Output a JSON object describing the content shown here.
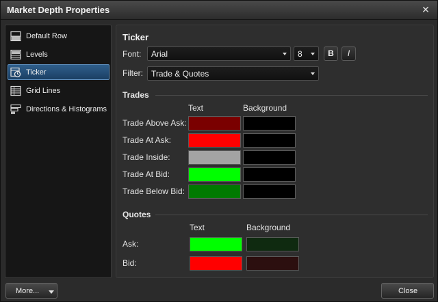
{
  "window": {
    "title": "Market Depth Properties"
  },
  "sidebar": {
    "items": [
      {
        "label": "Default Row",
        "icon": "default-row-icon"
      },
      {
        "label": "Levels",
        "icon": "levels-icon"
      },
      {
        "label": "Ticker",
        "icon": "ticker-icon",
        "active": true
      },
      {
        "label": "Grid Lines",
        "icon": "grid-lines-icon"
      },
      {
        "label": "Directions & Histograms",
        "icon": "directions-histograms-icon"
      }
    ]
  },
  "ticker": {
    "heading": "Ticker",
    "font_label": "Font:",
    "font_value": "Arial",
    "size_value": "8",
    "bold_label": "B",
    "italic_label": "I",
    "filter_label": "Filter:",
    "filter_value": "Trade & Quotes"
  },
  "trades": {
    "heading": "Trades",
    "col_text": "Text",
    "col_background": "Background",
    "rows": [
      {
        "label": "Trade Above Ask:",
        "text_color": "#7a0000",
        "bg_color": "#000000"
      },
      {
        "label": "Trade At Ask:",
        "text_color": "#ff0000",
        "bg_color": "#000000"
      },
      {
        "label": "Trade Inside:",
        "text_color": "#a3a3a3",
        "bg_color": "#000000"
      },
      {
        "label": "Trade At Bid:",
        "text_color": "#00ff00",
        "bg_color": "#000000"
      },
      {
        "label": "Trade Below Bid:",
        "text_color": "#007a00",
        "bg_color": "#000000"
      }
    ]
  },
  "quotes": {
    "heading": "Quotes",
    "col_text": "Text",
    "col_background": "Background",
    "rows": [
      {
        "label": "Ask:",
        "text_color": "#00ff00",
        "bg_color": "#0f2a10"
      },
      {
        "label": "Bid:",
        "text_color": "#ff0000",
        "bg_color": "#2c0f0f"
      }
    ]
  },
  "footer": {
    "more_label": "More...",
    "close_label": "Close"
  }
}
